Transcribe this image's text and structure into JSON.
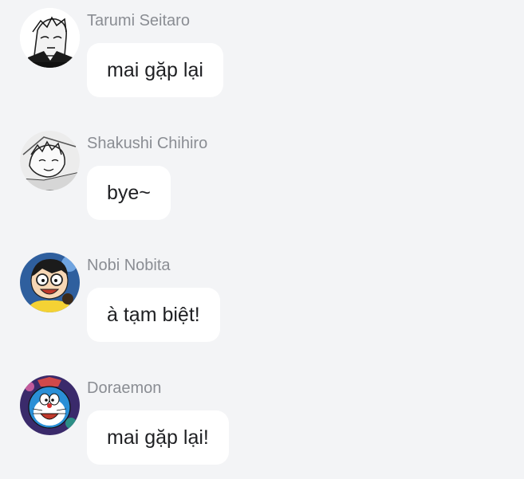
{
  "messages": [
    {
      "sender": "Tarumi Seitaro",
      "text": "mai gặp lại",
      "avatar_icon": "manga-sketch-avatar-icon"
    },
    {
      "sender": "Shakushi Chihiro",
      "text": "bye~",
      "avatar_icon": "manga-sketch-avatar-icon"
    },
    {
      "sender": "Nobi Nobita",
      "text": "à tạm biệt!",
      "avatar_icon": "nobita-avatar-icon"
    },
    {
      "sender": "Doraemon",
      "text": "mai gặp lại!",
      "avatar_icon": "doraemon-avatar-icon"
    }
  ],
  "colors": {
    "background": "#f3f4f6",
    "bubble": "#ffffff",
    "sender_text": "#8a8d93",
    "message_text": "#1f2023"
  }
}
